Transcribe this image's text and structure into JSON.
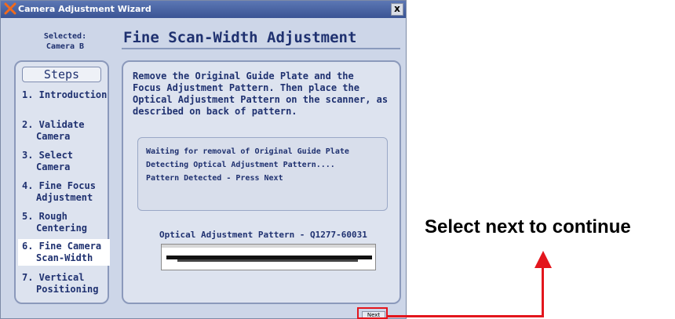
{
  "window": {
    "title": "Camera Adjustment Wizard",
    "close_label": "x"
  },
  "header": {
    "selected_label": "Selected:",
    "selected_value": "Camera B",
    "page_title": "Fine Scan-Width Adjustment"
  },
  "steps": {
    "heading": "Steps",
    "items": [
      {
        "lines": [
          "1. Introduction"
        ]
      },
      {
        "lines": [
          "2. Validate",
          "Camera"
        ]
      },
      {
        "lines": [
          "3. Select",
          "Camera"
        ]
      },
      {
        "lines": [
          "4. Fine Focus",
          "Adjustment"
        ]
      },
      {
        "lines": [
          "5. Rough",
          "Centering"
        ]
      },
      {
        "lines": [
          "6. Fine Camera",
          "Scan-Width"
        ],
        "active": true
      },
      {
        "lines": [
          "7. Vertical",
          "Positioning"
        ]
      }
    ]
  },
  "main": {
    "instructions": [
      "Remove the Original Guide Plate and the",
      "Focus Adjustment Pattern. Then place the",
      "Optical Adjustment Pattern on the scanner, as",
      "described on back of pattern."
    ],
    "status_lines": [
      "Waiting for removal of Original Guide Plate",
      "Detecting Optical Adjustment Pattern....",
      "Pattern Detected - Press Next"
    ],
    "pattern_label": "Optical Adjustment Pattern - Q1277-60031"
  },
  "buttons": {
    "next_label": "Next"
  },
  "annotation": {
    "callout_text": "Select next to continue",
    "arrow_color": "#e3161d"
  }
}
